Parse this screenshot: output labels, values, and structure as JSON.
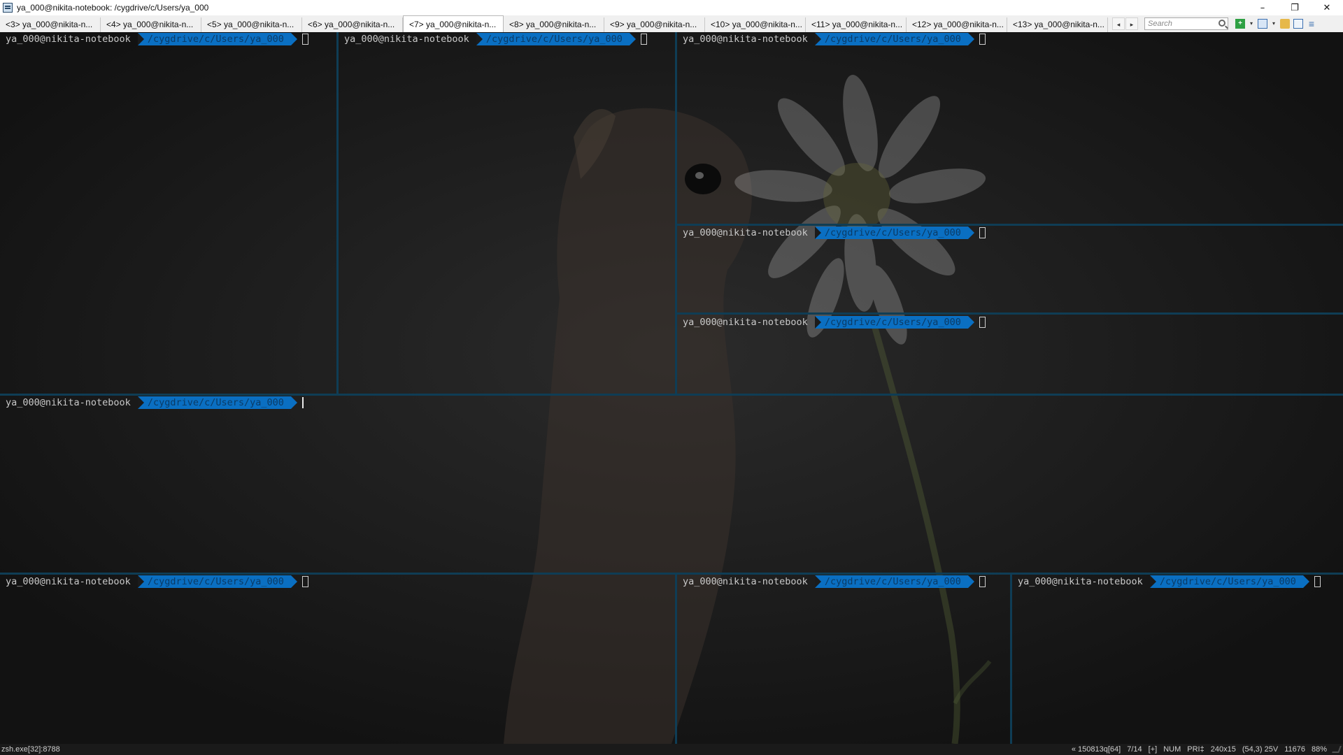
{
  "window": {
    "title": "ya_000@nikita-notebook: /cygdrive/c/Users/ya_000",
    "controls": {
      "minimize": "–",
      "restore": "❐",
      "close": "✕"
    }
  },
  "tabs": [
    {
      "label": "<3> ya_000@nikita-n...",
      "active": false
    },
    {
      "label": "<4> ya_000@nikita-n...",
      "active": false
    },
    {
      "label": "<5> ya_000@nikita-n...",
      "active": false
    },
    {
      "label": "<6> ya_000@nikita-n...",
      "active": false
    },
    {
      "label": "<7> ya_000@nikita-n...",
      "active": true
    },
    {
      "label": "<8> ya_000@nikita-n...",
      "active": false
    },
    {
      "label": "<9> ya_000@nikita-n...",
      "active": false
    },
    {
      "label": "<10> ya_000@nikita-n...",
      "active": false
    },
    {
      "label": "<11> ya_000@nikita-n...",
      "active": false
    },
    {
      "label": "<12> ya_000@nikita-n...",
      "active": false
    },
    {
      "label": "<13> ya_000@nikita-n...",
      "active": false
    }
  ],
  "tab_nav": {
    "prev": "◂",
    "next": "▸"
  },
  "search": {
    "placeholder": "Search"
  },
  "toolbar": {
    "new_console": "+",
    "dropdown": "▾",
    "menu": "≡"
  },
  "prompt": {
    "user": "ya_000@nikita-notebook",
    "path": "/cygdrive/c/Users/ya_000"
  },
  "panes": [
    {
      "id": "top-left",
      "active": false
    },
    {
      "id": "top-middle",
      "active": false
    },
    {
      "id": "top-right",
      "active": false
    },
    {
      "id": "right-mid-1",
      "active": false
    },
    {
      "id": "right-mid-2",
      "active": false
    },
    {
      "id": "middle-wide",
      "active": true
    },
    {
      "id": "bottom-left",
      "active": false
    },
    {
      "id": "bottom-middle",
      "active": false
    },
    {
      "id": "bottom-right",
      "active": false
    }
  ],
  "status": {
    "process": "zsh.exe[32]:8788",
    "items": [
      "« 150813q[64]",
      "7/14",
      "[+]",
      "NUM",
      "PRI‡",
      "240x15",
      "(54,3) 25V",
      "11676",
      "88%"
    ]
  }
}
